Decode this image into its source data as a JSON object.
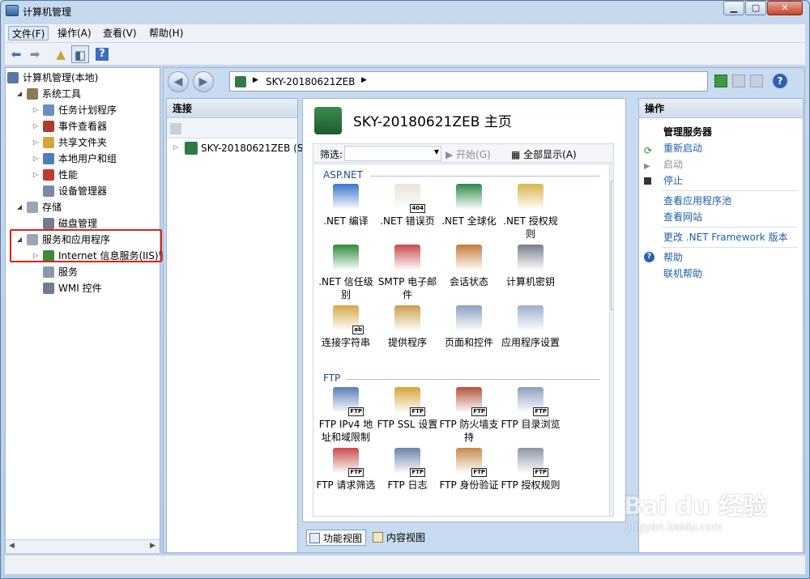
{
  "window": {
    "title": "计算机管理"
  },
  "menu": [
    "文件(F)",
    "操作(A)",
    "查看(V)",
    "帮助(H)"
  ],
  "tree": [
    {
      "label": "计算机管理(本地)",
      "level": 0,
      "arrow": "",
      "color": "#5577aa"
    },
    {
      "label": "系统工具",
      "level": 1,
      "arrow": "◢",
      "color": "#8a7a52"
    },
    {
      "label": "任务计划程序",
      "level": 2,
      "arrow": "▷",
      "color": "#6c8dbf"
    },
    {
      "label": "事件查看器",
      "level": 2,
      "arrow": "▷",
      "color": "#b03a2e"
    },
    {
      "label": "共享文件夹",
      "level": 2,
      "arrow": "▷",
      "color": "#d4a637"
    },
    {
      "label": "本地用户和组",
      "level": 2,
      "arrow": "▷",
      "color": "#4f7db8"
    },
    {
      "label": "性能",
      "level": 2,
      "arrow": "▷",
      "color": "#c0392b"
    },
    {
      "label": "设备管理器",
      "level": 2,
      "arrow": "",
      "color": "#7a8aa0"
    },
    {
      "label": "存储",
      "level": 1,
      "arrow": "◢",
      "color": "#9aa5b5"
    },
    {
      "label": "磁盘管理",
      "level": 2,
      "arrow": "",
      "color": "#6f7d90"
    },
    {
      "label": "服务和应用程序",
      "level": 1,
      "arrow": "◢",
      "color": "#9aa5b5"
    },
    {
      "label": "Internet 信息服务(IIS)管",
      "level": 2,
      "arrow": "▷",
      "color": "#3f8a3f"
    },
    {
      "label": "服务",
      "level": 2,
      "arrow": "",
      "color": "#8899aa"
    },
    {
      "label": "WMI 控件",
      "level": 2,
      "arrow": "",
      "color": "#6f7d90"
    }
  ],
  "iis": {
    "address": "SKY-20180621ZEB",
    "connections_title": "连接",
    "connection_node": "SKY-20180621ZEB (S",
    "home_title": "SKY-20180621ZEB 主页",
    "filter_label": "筛选:",
    "start_label": "开始(G)",
    "show_all_label": "全部显示(A)",
    "sections": [
      {
        "name": "ASP.NET",
        "features": [
          {
            "label": ".NET 编译",
            "color": "#3a74c9",
            "tag": ""
          },
          {
            "label": ".NET 错误页",
            "color": "#e8e4d6",
            "tag": "404"
          },
          {
            "label": ".NET 全球化",
            "color": "#2f8a4a",
            "tag": ""
          },
          {
            "label": ".NET 授权规则",
            "color": "#d8b44a",
            "tag": ""
          },
          {
            "label": ".NET 信任级别",
            "color": "#2e8b3a",
            "tag": ""
          },
          {
            "label": "SMTP 电子邮件",
            "color": "#c94a4a",
            "tag": ""
          },
          {
            "label": "会话状态",
            "color": "#c97a3a",
            "tag": ""
          },
          {
            "label": "计算机密钥",
            "color": "#777f8a",
            "tag": ""
          },
          {
            "label": "连接字符串",
            "color": "#d6a84a",
            "tag": "ab"
          },
          {
            "label": "提供程序",
            "color": "#caa04a",
            "tag": ""
          },
          {
            "label": "页面和控件",
            "color": "#8ba0c0",
            "tag": ""
          },
          {
            "label": "应用程序设置",
            "color": "#9fb0c8",
            "tag": ""
          }
        ]
      },
      {
        "name": "FTP",
        "features": [
          {
            "label": "FTP IPv4 地址和域限制",
            "color": "#5a7fb8",
            "tag": "FTP"
          },
          {
            "label": "FTP SSL 设置",
            "color": "#d4a637",
            "tag": "FTP"
          },
          {
            "label": "FTP 防火墙支持",
            "color": "#b5533a",
            "tag": "FTP"
          },
          {
            "label": "FTP 目录浏览",
            "color": "#8ca0bf",
            "tag": "FTP"
          },
          {
            "label": "FTP 请求筛选",
            "color": "#c94a4a",
            "tag": "FTP"
          },
          {
            "label": "FTP 日志",
            "color": "#6a82aa",
            "tag": "FTP"
          },
          {
            "label": "FTP 身份验证",
            "color": "#c98a4a",
            "tag": "FTP"
          },
          {
            "label": "FTP 授权规则",
            "color": "#8c96a6",
            "tag": "FTP"
          }
        ]
      }
    ],
    "view_tabs": [
      "功能视图",
      "内容视图"
    ],
    "actions_title": "操作",
    "actions": {
      "group": "管理服务器",
      "restart": "重新启动",
      "start": "启动",
      "stop": "停止",
      "view_app_pools": "查看应用程序池",
      "view_sites": "查看网站",
      "change_framework": "更改 .NET Framework 版本",
      "help": "帮助",
      "online_help": "联机帮助"
    }
  },
  "watermark": {
    "brand": "Bai du 经验",
    "url": "jingyan.baidu.com"
  }
}
